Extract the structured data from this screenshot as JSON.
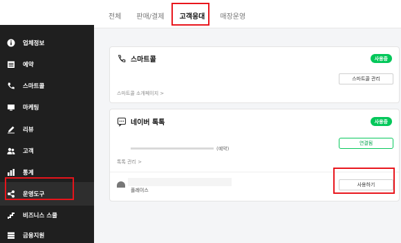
{
  "tabs": [
    {
      "label": "전체"
    },
    {
      "label": "판매/결제"
    },
    {
      "label": "고객응대"
    },
    {
      "label": "매장운영"
    }
  ],
  "sidebar": {
    "items": [
      {
        "label": "업체정보",
        "icon": "info-icon"
      },
      {
        "label": "예약",
        "icon": "calendar-icon"
      },
      {
        "label": "스마트콜",
        "icon": "phone-icon"
      },
      {
        "label": "마케팅",
        "icon": "tv-icon"
      },
      {
        "label": "리뷰",
        "icon": "pen-icon"
      },
      {
        "label": "고객",
        "icon": "users-icon"
      },
      {
        "label": "통계",
        "icon": "chart-icon"
      },
      {
        "label": "운영도구",
        "icon": "tool-icon"
      },
      {
        "label": "비즈니스 스쿨",
        "icon": "stairs-icon"
      },
      {
        "label": "금융지원",
        "icon": "money-icon"
      }
    ]
  },
  "cards": {
    "smartcall": {
      "title": "스마트콜",
      "badge": "사용중",
      "button": "스마트콜 관리",
      "link": "스마트콜 소개페이지 >"
    },
    "talk": {
      "title": "네이버 톡톡",
      "badge": "사용중",
      "connected_button": "연결됨",
      "connected_text": "(예약)",
      "link": "톡톡 관리 >",
      "place_text": "플레이스",
      "use_button": "사용하기"
    }
  },
  "colors": {
    "sidebar_bg": "#1f1f1f",
    "accent_green": "#03c75a",
    "highlight_red": "#e8141b"
  }
}
